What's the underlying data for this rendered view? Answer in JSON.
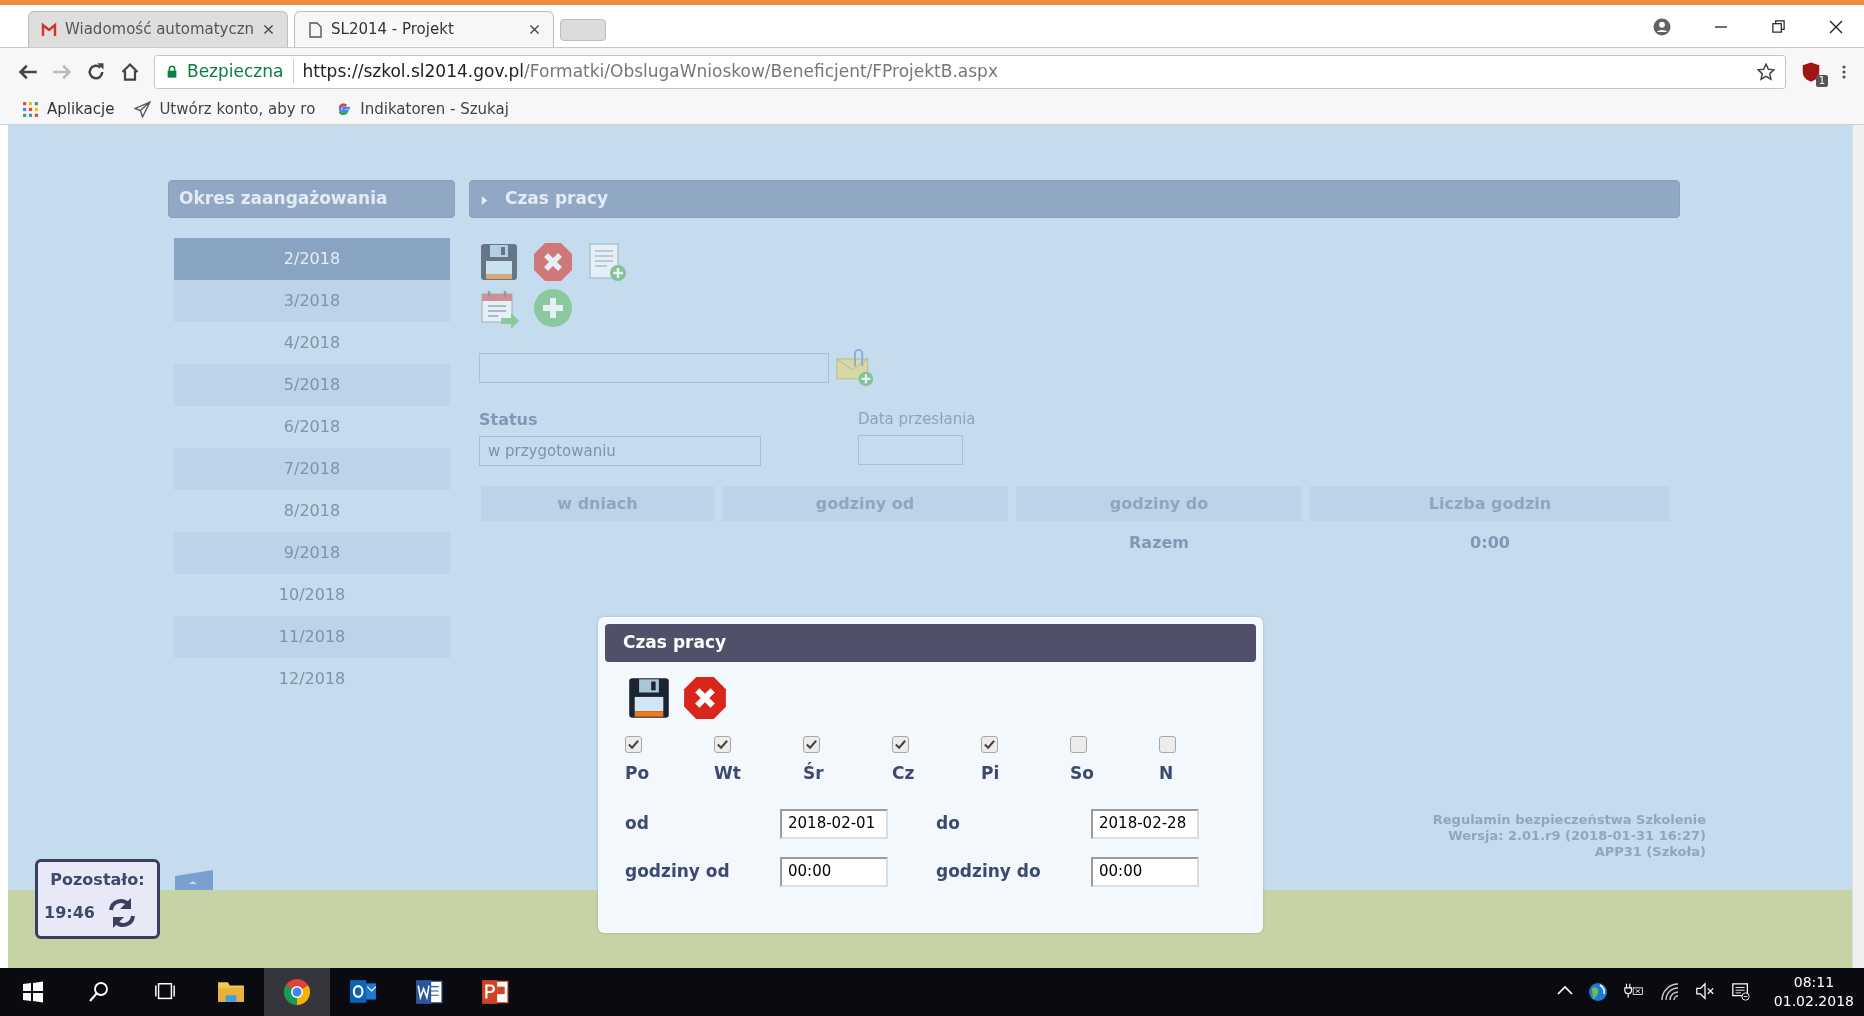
{
  "browser": {
    "tabs": [
      {
        "title": "Wiadomość automatyczn",
        "selected": false,
        "kind": "mail"
      },
      {
        "title": "SL2014 - Projekt",
        "selected": true,
        "kind": "page"
      }
    ],
    "security_label": "Bezpieczna",
    "url_host": "https://szkol.sl2014.gov.pl",
    "url_path": "/Formatki/ObslugaWnioskow/Beneficjent/FProjektB.aspx",
    "extension_badge": "1",
    "bookmarks": [
      {
        "label": "Aplikacje",
        "kind": "apps"
      },
      {
        "label": "Utwórz konto, aby ro",
        "kind": "send"
      },
      {
        "label": "Indikatoren - Szukaj",
        "kind": "google"
      }
    ]
  },
  "sidebar": {
    "title": "Okres zaangażowania",
    "items": [
      {
        "label": "2/2018",
        "selected": true
      },
      {
        "label": "3/2018",
        "selected": false
      },
      {
        "label": "4/2018",
        "selected": false
      },
      {
        "label": "5/2018",
        "selected": false
      },
      {
        "label": "6/2018",
        "selected": false
      },
      {
        "label": "7/2018",
        "selected": false
      },
      {
        "label": "8/2018",
        "selected": false
      },
      {
        "label": "9/2018",
        "selected": false
      },
      {
        "label": "10/2018",
        "selected": false
      },
      {
        "label": "11/2018",
        "selected": false
      },
      {
        "label": "12/2018",
        "selected": false
      }
    ]
  },
  "panel": {
    "title": "Czas pracy",
    "status_label": "Status",
    "status_value": "w przygotowaniu",
    "date_label": "Data przesłania",
    "table": {
      "columns": [
        "w dniach",
        "godziny od",
        "godziny do",
        "Liczba godzin"
      ],
      "total_label": "Razem",
      "total_value": "0:00"
    }
  },
  "footer": {
    "links": [
      "Regulamin bezpieczeństwa",
      "Szkolenie"
    ],
    "version": "Wersja:  2.01.r9 (2018-01-31 16:27)",
    "server": "APP31 (Szkoła)"
  },
  "timer": {
    "label": "Pozostało:",
    "value": "19:46"
  },
  "dialog": {
    "title": "Czas pracy",
    "days": [
      {
        "label": "Po",
        "checked": true
      },
      {
        "label": "Wt",
        "checked": true
      },
      {
        "label": "Śr",
        "checked": true
      },
      {
        "label": "Cz",
        "checked": true
      },
      {
        "label": "Pi",
        "checked": true
      },
      {
        "label": "So",
        "checked": false
      },
      {
        "label": "N",
        "checked": false
      }
    ],
    "fields": [
      {
        "label": "od",
        "value": "2018-02-01"
      },
      {
        "label": "do",
        "value": "2018-02-28"
      },
      {
        "label": "godziny od",
        "value": "00:00"
      },
      {
        "label": "godziny do",
        "value": "00:00"
      }
    ]
  },
  "taskbar": {
    "apps": [
      {
        "kind": "explorer",
        "selected": false
      },
      {
        "kind": "chrome",
        "selected": true
      },
      {
        "kind": "outlook",
        "selected": false
      },
      {
        "kind": "word",
        "selected": false
      },
      {
        "kind": "powerpoint",
        "selected": false
      }
    ],
    "time": "08:11",
    "date": "01.02.2018"
  }
}
